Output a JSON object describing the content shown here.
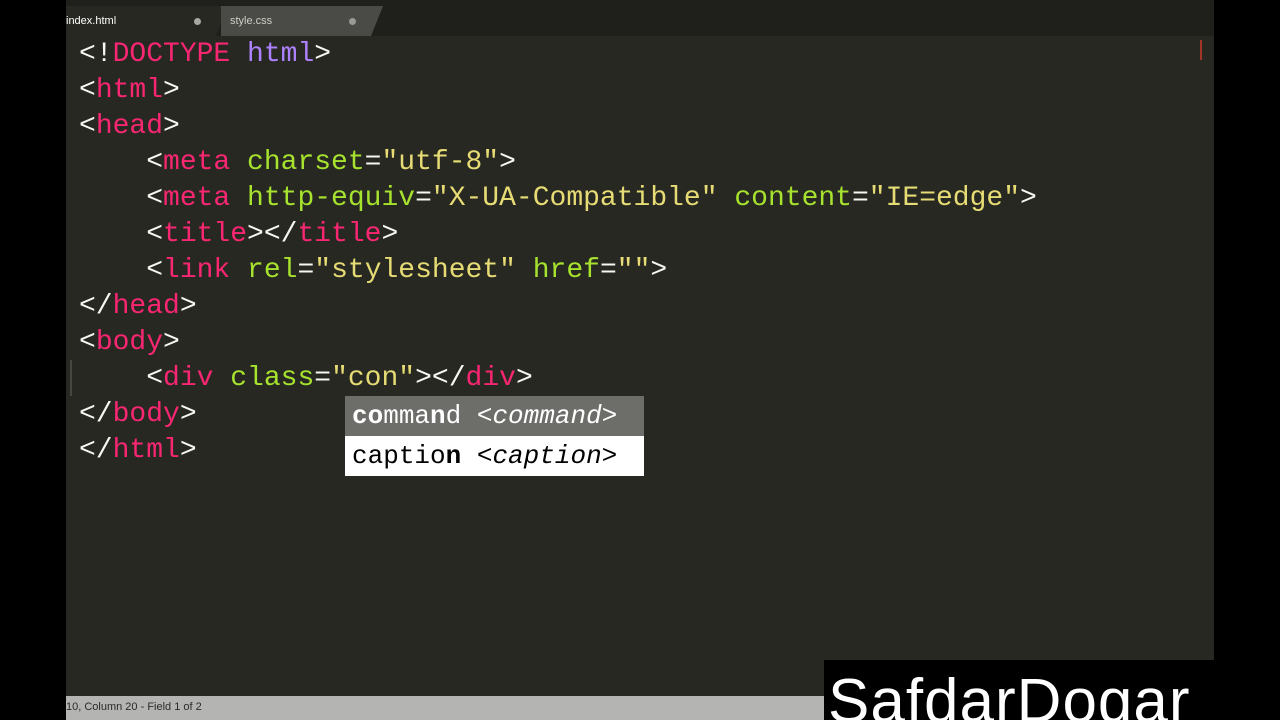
{
  "tabs": [
    {
      "label": "index.html",
      "active": true,
      "dirty": true
    },
    {
      "label": "style.css",
      "active": false,
      "dirty": true
    }
  ],
  "code_lines": [
    [
      {
        "t": "punct",
        "v": "<!"
      },
      {
        "t": "tag",
        "v": "DOCTYPE"
      },
      {
        "t": "punct",
        "v": " "
      },
      {
        "t": "kw",
        "v": "html"
      },
      {
        "t": "punct",
        "v": ">"
      }
    ],
    [
      {
        "t": "punct",
        "v": "<"
      },
      {
        "t": "tag",
        "v": "html"
      },
      {
        "t": "punct",
        "v": ">"
      }
    ],
    [
      {
        "t": "punct",
        "v": "<"
      },
      {
        "t": "tag",
        "v": "head"
      },
      {
        "t": "punct",
        "v": ">"
      }
    ],
    [
      {
        "t": "punct",
        "v": "    <"
      },
      {
        "t": "tag",
        "v": "meta"
      },
      {
        "t": "punct",
        "v": " "
      },
      {
        "t": "attr",
        "v": "charset"
      },
      {
        "t": "punct",
        "v": "="
      },
      {
        "t": "str",
        "v": "\"utf-8\""
      },
      {
        "t": "punct",
        "v": ">"
      }
    ],
    [
      {
        "t": "punct",
        "v": "    <"
      },
      {
        "t": "tag",
        "v": "meta"
      },
      {
        "t": "punct",
        "v": " "
      },
      {
        "t": "attr",
        "v": "http-equiv"
      },
      {
        "t": "punct",
        "v": "="
      },
      {
        "t": "str",
        "v": "\"X-UA-Compatible\""
      },
      {
        "t": "punct",
        "v": " "
      },
      {
        "t": "attr",
        "v": "content"
      },
      {
        "t": "punct",
        "v": "="
      },
      {
        "t": "str",
        "v": "\"IE=edge\""
      },
      {
        "t": "punct",
        "v": ">"
      }
    ],
    [
      {
        "t": "punct",
        "v": "    <"
      },
      {
        "t": "tag",
        "v": "title"
      },
      {
        "t": "punct",
        "v": "></"
      },
      {
        "t": "tag",
        "v": "title"
      },
      {
        "t": "punct",
        "v": ">"
      }
    ],
    [
      {
        "t": "punct",
        "v": "    <"
      },
      {
        "t": "tag",
        "v": "link"
      },
      {
        "t": "punct",
        "v": " "
      },
      {
        "t": "attr",
        "v": "rel"
      },
      {
        "t": "punct",
        "v": "="
      },
      {
        "t": "str",
        "v": "\"stylesheet\""
      },
      {
        "t": "punct",
        "v": " "
      },
      {
        "t": "attr",
        "v": "href"
      },
      {
        "t": "punct",
        "v": "="
      },
      {
        "t": "str",
        "v": "\"\""
      },
      {
        "t": "punct",
        "v": ">"
      }
    ],
    [
      {
        "t": "punct",
        "v": "</"
      },
      {
        "t": "tag",
        "v": "head"
      },
      {
        "t": "punct",
        "v": ">"
      }
    ],
    [
      {
        "t": "punct",
        "v": "<"
      },
      {
        "t": "tag",
        "v": "body"
      },
      {
        "t": "punct",
        "v": ">"
      }
    ],
    [
      {
        "t": "punct",
        "v": "    <"
      },
      {
        "t": "tag",
        "v": "div"
      },
      {
        "t": "punct",
        "v": " "
      },
      {
        "t": "attr",
        "v": "class"
      },
      {
        "t": "punct",
        "v": "="
      },
      {
        "t": "str",
        "v": "\"con\""
      },
      {
        "t": "punct",
        "v": "></"
      },
      {
        "t": "tag",
        "v": "div"
      },
      {
        "t": "punct",
        "v": ">"
      }
    ],
    [
      {
        "t": "punct",
        "v": "</"
      },
      {
        "t": "tag",
        "v": "body"
      },
      {
        "t": "punct",
        "v": ">"
      }
    ],
    [
      {
        "t": "punct",
        "v": "</"
      },
      {
        "t": "tag",
        "v": "html"
      },
      {
        "t": "punct",
        "v": ">"
      }
    ]
  ],
  "autocomplete": {
    "items": [
      {
        "segments": [
          {
            "v": "co",
            "m": true
          },
          {
            "v": "mma",
            "m": false
          },
          {
            "v": "n",
            "m": true
          },
          {
            "v": "d",
            "m": false
          }
        ],
        "hint": " <command>",
        "selected": true
      },
      {
        "segments": [
          {
            "v": "ca",
            "m": false
          },
          {
            "v": "ptio",
            "m": false
          },
          {
            "v": "n",
            "m": true
          }
        ],
        "hint": " <caption>",
        "selected": false
      }
    ]
  },
  "status": {
    "text": "10, Column 20 - Field 1 of 2"
  },
  "watermark": {
    "text": "SafdarDogar"
  },
  "colors": {
    "background": "#272822",
    "tag": "#f92672",
    "attribute": "#a6e22e",
    "string": "#e6db74",
    "keyword": "#ae81ff",
    "text": "#f8f8f2"
  }
}
